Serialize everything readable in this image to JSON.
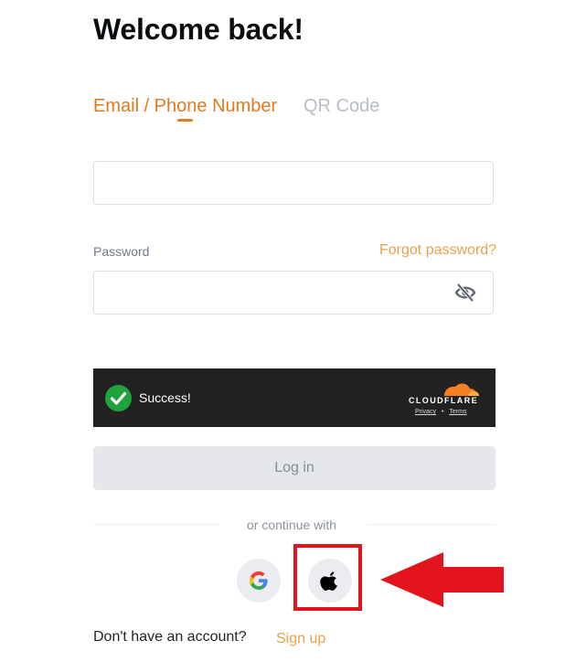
{
  "header": {
    "title": "Welcome back!"
  },
  "tabs": [
    {
      "label": "Email / Phone Number",
      "active": true
    },
    {
      "label": "QR Code",
      "active": false
    }
  ],
  "form": {
    "email": {
      "value": "",
      "placeholder": ""
    },
    "password": {
      "label": "Password",
      "value": "",
      "placeholder": ""
    },
    "forgot_password": "Forgot password?",
    "toggle_visibility_icon": "eye-slash-icon"
  },
  "captcha": {
    "status": "Success!",
    "provider": "CLOUDFLARE",
    "privacy_link": "Privacy",
    "separator": "•",
    "terms_link": "Terms"
  },
  "login_button": "Log in",
  "social": {
    "divider_text": "or continue with",
    "providers": [
      "google-icon",
      "apple-icon"
    ]
  },
  "footer": {
    "no_account_text": "Don't have an account?",
    "signup_link": "Sign up"
  },
  "colors": {
    "accent": "#e07a1f",
    "link": "#e8a14a",
    "success": "#1fa33a",
    "highlight": "#e3141c"
  }
}
